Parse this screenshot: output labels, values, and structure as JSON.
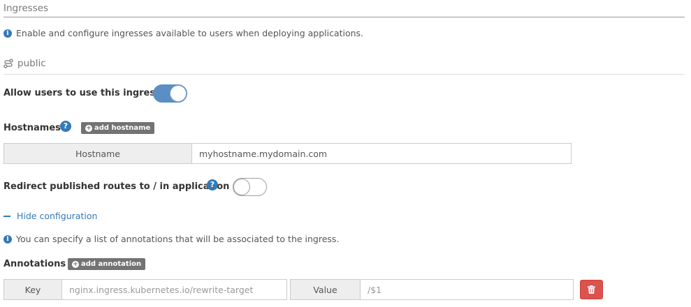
{
  "section": {
    "title": "Ingresses",
    "info": "Enable and configure ingresses available to users when deploying applications."
  },
  "ingress": {
    "name": "public",
    "allow_label": "Allow users to use this ingress",
    "allow_enabled": true,
    "hostnames_label": "Hostnames",
    "add_hostname_label": "add hostname",
    "hostname_addon": "Hostname",
    "hostname_value": "myhostname.mydomain.com",
    "redirect_label": "Redirect published routes to / in application",
    "redirect_enabled": false,
    "hide_config_label": "Hide configuration",
    "annotations_info": "You can specify a list of annotations that will be associated to the ingress.",
    "annotations_label": "Annotations",
    "add_annotation_label": "add annotation",
    "annotation": {
      "key_addon": "Key",
      "key_placeholder": "nginx.ingress.kubernetes.io/rewrite-target",
      "value_addon": "Value",
      "value_placeholder": "/$1"
    }
  },
  "icons": {
    "info": "info-circle-icon",
    "route": "route-icon",
    "help": "question-circle-icon",
    "plus": "plus-circle-icon",
    "minus": "minus-icon",
    "trash": "trash-icon"
  },
  "colors": {
    "primary": "#337ab7",
    "toggle_on": "#5b8ec5",
    "danger": "#d9534f",
    "tag": "#737373"
  }
}
